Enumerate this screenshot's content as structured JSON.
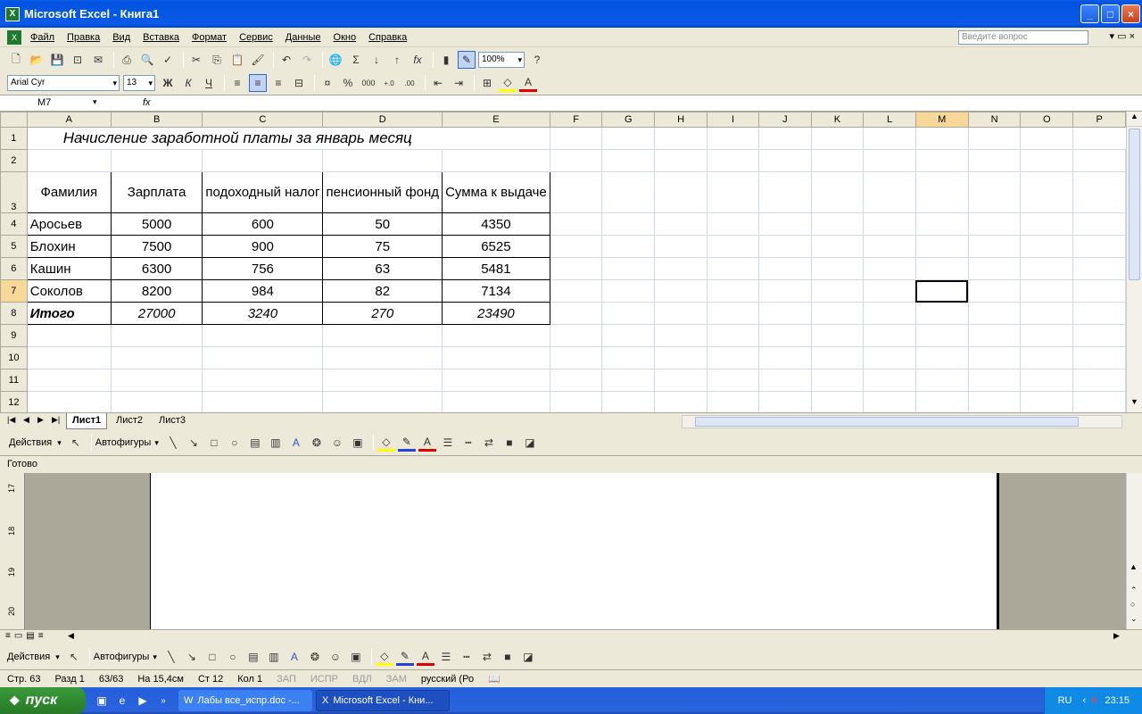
{
  "window": {
    "title": "Microsoft Excel - Книга1"
  },
  "menu": {
    "items": [
      "Файл",
      "Правка",
      "Вид",
      "Вставка",
      "Формат",
      "Сервис",
      "Данные",
      "Окно",
      "Справка"
    ],
    "help_placeholder": "Введите вопрос"
  },
  "toolbar": {
    "zoom": "100%",
    "font": "Arial Cyr",
    "size": "13"
  },
  "formula_bar": {
    "namebox": "M7",
    "fx": "fx",
    "value": ""
  },
  "sheet": {
    "columns": [
      "A",
      "B",
      "C",
      "D",
      "E",
      "F",
      "G",
      "H",
      "I",
      "J",
      "K",
      "L",
      "M",
      "N",
      "O",
      "P"
    ],
    "selected_column": "M",
    "rows": [
      "1",
      "2",
      "3",
      "4",
      "5",
      "6",
      "7",
      "8",
      "9",
      "10",
      "11",
      "12"
    ],
    "title": "Начисление заработной платы за январь месяц",
    "headers": [
      "Фамилия",
      "Зарплата",
      "подоходный налог",
      "пенсионный фонд",
      "Сумма к выдаче"
    ],
    "data": [
      [
        "Аросьев",
        "5000",
        "600",
        "50",
        "4350"
      ],
      [
        "Блохин",
        "7500",
        "900",
        "75",
        "6525"
      ],
      [
        "Кашин",
        "6300",
        "756",
        "63",
        "5481"
      ],
      [
        "Соколов",
        "8200",
        "984",
        "82",
        "7134"
      ]
    ],
    "total": [
      "Итого",
      "27000",
      "3240",
      "270",
      "23490"
    ]
  },
  "tabs": [
    "Лист1",
    "Лист2",
    "Лист3"
  ],
  "drawing": {
    "actions": "Действия",
    "autoshapes": "Автофигуры"
  },
  "status": "Готово",
  "word_ruler": [
    "17",
    "18",
    "19",
    "20"
  ],
  "word_status": {
    "page": "Стр. 63",
    "section": "Разд 1",
    "pages": "63/63",
    "at": "На 15,4см",
    "line": "Ст 12",
    "col": "Кол 1",
    "rec": "ЗАП",
    "trk": "ИСПР",
    "ext": "ВДЛ",
    "ovr": "ЗАМ",
    "lang": "русский (Ро"
  },
  "taskbar": {
    "start": "пуск",
    "tasks": [
      "Лабы все_испр.doc -...",
      "Microsoft Excel - Кни..."
    ],
    "lang": "RU",
    "time": "23:15"
  }
}
